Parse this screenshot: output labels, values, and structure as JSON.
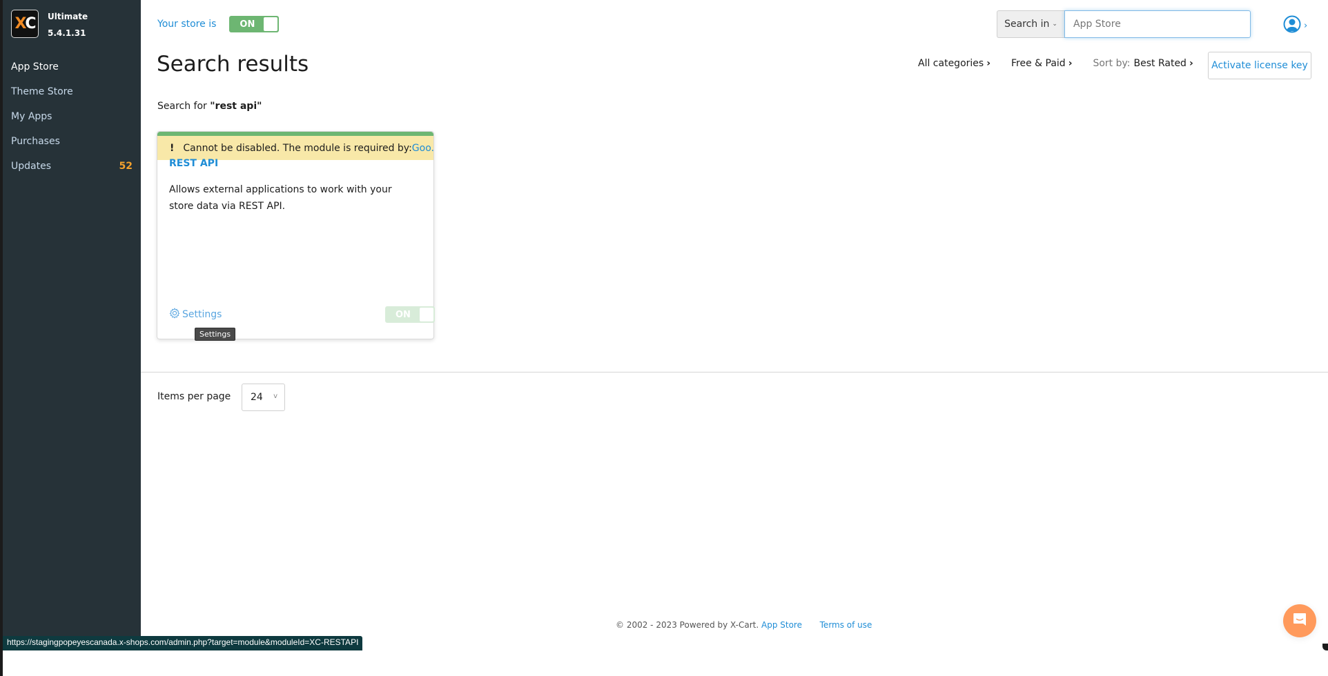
{
  "sidebar": {
    "logo": {
      "letters_orange": "X",
      "letters_white": "C"
    },
    "edition": "Ultimate",
    "version": "5.4.1.31",
    "items": [
      {
        "label": "App Store",
        "active": true,
        "badge": ""
      },
      {
        "label": "Theme Store",
        "active": false,
        "badge": ""
      },
      {
        "label": "My Apps",
        "active": false,
        "badge": ""
      },
      {
        "label": "Purchases",
        "active": false,
        "badge": ""
      },
      {
        "label": "Updates",
        "active": false,
        "badge": "52"
      }
    ]
  },
  "header": {
    "store_status_label": "Your store is",
    "store_toggle": "ON",
    "search_in_label": "Search in",
    "search_placeholder": "App Store",
    "search_value": "",
    "user_icon": "user-avatar-icon"
  },
  "main": {
    "title": "Search results",
    "filters": {
      "categories": "All categories",
      "pricing": "Free & Paid",
      "sort_label": "Sort by:",
      "sort_value": "Best Rated"
    },
    "activate_license_label": "Activate license key",
    "search_for_prefix": "Search for",
    "search_query": "\"rest api\"",
    "results": [
      {
        "warning_mark": "!",
        "warning_text": "Cannot be disabled. The module is required by: ",
        "warning_link": "Goo...",
        "title": "REST API",
        "description": "Allows external applications to work with your store data via REST API.",
        "settings_label": "Settings",
        "settings_tooltip": "Settings",
        "toggle_state": "ON",
        "toggle_disabled": true
      }
    ],
    "items_per_page_label": "Items per page",
    "items_per_page_value": "24"
  },
  "footer": {
    "copyright": "© 2002 - 2023 Powered by X-Cart.",
    "app_store_link": "App Store",
    "terms_link": "Terms of use"
  },
  "status_bar_url": "https://stagingpopeyescanada.x-shops.com/admin.php?target=module&moduleId=XC-RESTAPI",
  "colors": {
    "accent": "#1f8dd6",
    "sidebar_bg": "#263238",
    "toggle_on": "#6db672",
    "warning_bg": "#f8e8a8",
    "badge": "#f4a12d",
    "chat": "#ff9a5c"
  }
}
